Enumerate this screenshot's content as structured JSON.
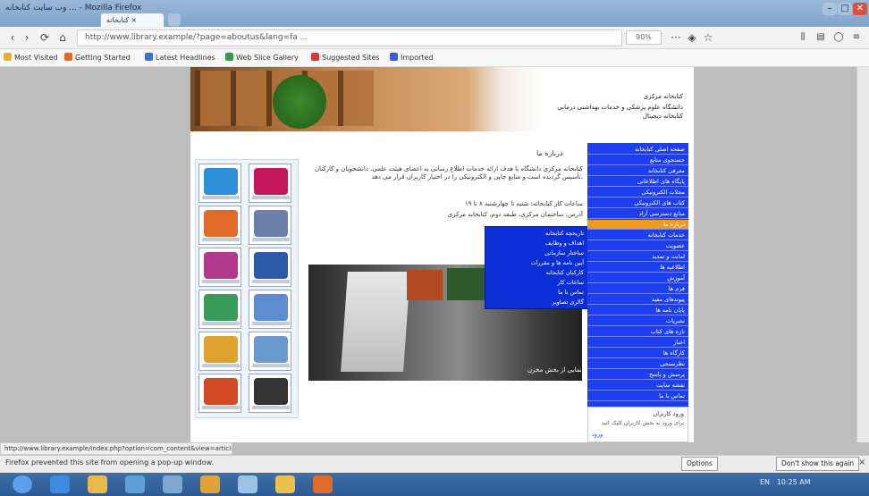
{
  "window": {
    "title": "وب سایت کتابخانه ... - Mozilla Firefox",
    "tab_label": "کتابخانه ×",
    "new_tab": "+",
    "min": "–",
    "max": "□",
    "close": "✕"
  },
  "nav": {
    "back": "‹",
    "forward": "›",
    "reload": "⟳",
    "home": "⌂",
    "url": "http://www.library.example/?page=aboutus&lang=fa ...",
    "zoom": "90%",
    "more": "···",
    "bookmark_star": "☆",
    "shield": "◈"
  },
  "bookmarks": [
    {
      "label": "Most Visited",
      "color": "#e2b040"
    },
    {
      "label": "Getting Started",
      "color": "#e06b1f"
    },
    {
      "label": "Latest Headlines",
      "color": "#3b6fd1"
    },
    {
      "label": "Web Slice Gallery",
      "color": "#3b9a4a"
    },
    {
      "label": "Suggested Sites",
      "color": "#d33b3b"
    },
    {
      "label": "Imported",
      "color": "#3c5bd4"
    }
  ],
  "site": {
    "banner_line1": "کتابخانه مرکزی",
    "banner_line2": "دانشگاه علوم پزشکی و خدمات بهداشتی درمانی",
    "banner_line3": "کتابخانه دیجیتال",
    "content_heading": "درباره ما",
    "para1": "کتابخانه مرکزی دانشگاه با هدف ارائه خدمات اطلاع رسانی به اعضای هیئت علمی، دانشجویان و کارکنان تأسیس گردیده است و منابع چاپی و الکترونیکی را در اختیار کاربران قرار می دهد.",
    "para2": "ساعات کار کتابخانه: شنبه تا چهارشنبه ۸ تا ۱۹",
    "para3": "آدرس: ساختمان مرکزی، طبقه دوم، کتابخانه مرکزی",
    "photo_caption": "نمایی از بخش مخزن"
  },
  "submenu": [
    "تاریخچه کتابخانه",
    "اهداف و وظایف",
    "ساختار سازمانی",
    "آیین نامه ها و مقررات",
    "کارکنان کتابخانه",
    "ساعات کار",
    "تماس با ما",
    "گالری تصاویر"
  ],
  "rightnav": [
    "صفحه اصلی کتابخانه",
    "جستجوی منابع",
    "معرفی کتابخانه",
    "پایگاه های اطلاعاتی",
    "مجلات الکترونیکی",
    "کتاب های الکترونیکی",
    "منابع دسترسی آزاد",
    "درباره ما",
    "خدمات کتابخانه",
    "عضویت",
    "امانت و تمدید",
    "اطلاعیه ها",
    "آموزش",
    "فرم ها",
    "پیوندهای مفید",
    "پایان نامه ها",
    "نشریات",
    "تازه های کتاب",
    "اخبار",
    "کارگاه ها",
    "نظرسنجی",
    "پرسش و پاسخ",
    "نقشه سایت",
    "تماس با ما"
  ],
  "rightbox": {
    "title": "ورود کاربران",
    "line": "برای ورود به بخش کاربران کلیک کنید",
    "link": "ورود"
  },
  "status": {
    "url": "http://www.library.example/index.php?option=com_content&view=article&id=..."
  },
  "download": {
    "message": "Firefox prevented this site from opening a pop-up window.",
    "options": "Options",
    "dont_show": "Don't show this again"
  },
  "tray": {
    "time": "10:25 AM",
    "lang": "EN"
  },
  "taskbar_icons": [
    {
      "name": "start-icon",
      "color": "#5aa0ea"
    },
    {
      "name": "ie-icon",
      "color": "#3d8ae0"
    },
    {
      "name": "folder-icon",
      "color": "#e8b84a"
    },
    {
      "name": "media-icon",
      "color": "#5da0d8"
    },
    {
      "name": "settings-icon",
      "color": "#7fa8cf"
    },
    {
      "name": "chrome-icon",
      "color": "#e2a23a"
    },
    {
      "name": "files-icon",
      "color": "#9cc2e8"
    },
    {
      "name": "explorer-icon",
      "color": "#e8c04a"
    },
    {
      "name": "firefox-icon",
      "color": "#e06a2a"
    }
  ],
  "colors": {
    "nav_blue": "#1d3ff0",
    "nav_active": "#f29a1c",
    "submenu_blue": "#0b2fd6"
  },
  "tiles": [
    {
      "color": "#2e8fd9"
    },
    {
      "color": "#c2185b"
    },
    {
      "color": "#e06a2a"
    },
    {
      "color": "#6b7fa8"
    },
    {
      "color": "#b23a8c"
    },
    {
      "color": "#2b5aa8"
    },
    {
      "color": "#3a9a5a"
    },
    {
      "color": "#5b8dd0"
    },
    {
      "color": "#e0a22e"
    },
    {
      "color": "#6a9ad0"
    },
    {
      "color": "#d24a24"
    },
    {
      "color": "#333333"
    }
  ]
}
